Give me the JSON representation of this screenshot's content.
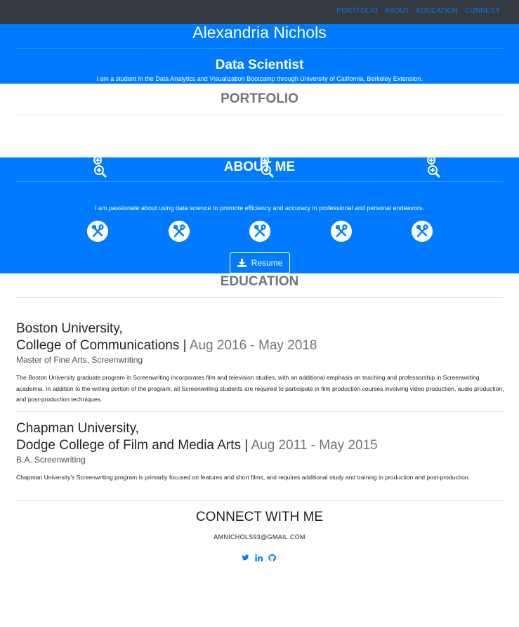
{
  "nav": {
    "links": [
      "PORTFOLIO",
      "ABOUT",
      "EDUCATION",
      "CONNECT"
    ]
  },
  "hero": {
    "name": "Alexandria Nichols",
    "title": "Data Scientist",
    "tagline": "I am a student in the Data Analytics and Visualization Bootcamp through University of California, Berkeley Extension."
  },
  "portfolio": {
    "heading": "PORTFOLIO",
    "icons": [
      "zoom-in-icon",
      "zoom-in-icon",
      "zoom-in-icon"
    ]
  },
  "about": {
    "heading": "ABOUT ME",
    "text": "I am passionate about using data science to promote efficiency and accuracy in professional and personal endeavors.",
    "skill_icons": [
      "tools-icon",
      "tools-icon",
      "tools-icon",
      "tools-icon",
      "tools-icon"
    ],
    "resume_label": "Resume"
  },
  "education": {
    "heading": "EDUCATION",
    "entries": [
      {
        "school_line1": "Boston University,",
        "school_line2": "College of Communications",
        "separator": " | ",
        "dates": "Aug 2016 - May 2018",
        "degree": "Master of Fine Arts, Screenwriting",
        "description": "The Boston University graduate program in Screenwriting incorporates film and television studies, with an additional emphasis on teaching and professorship in Screenwriting academia. In addition to the writing portion of the program, all Screenwriting students are required to participate in film production courses involving video production, audio production, and post-production techniques."
      },
      {
        "school_line1": "Chapman University,",
        "school_line2": "Dodge College of Film and Media Arts",
        "separator": " | ",
        "dates": "Aug 2011 - May 2015",
        "degree": "B.A. Screenwriting",
        "description": "Chapman University's Screenwriting program is primarily focused on features and short films, and requires additional study and training in production and post-production."
      }
    ]
  },
  "connect": {
    "heading": "CONNECT WITH ME",
    "email": "AMNICHOLS93@GMAIL.COM",
    "socials": [
      "twitter-icon",
      "linkedin-icon",
      "github-icon"
    ]
  },
  "colors": {
    "primary": "#007bff",
    "navbar": "#343a40",
    "muted": "#6c757d"
  }
}
